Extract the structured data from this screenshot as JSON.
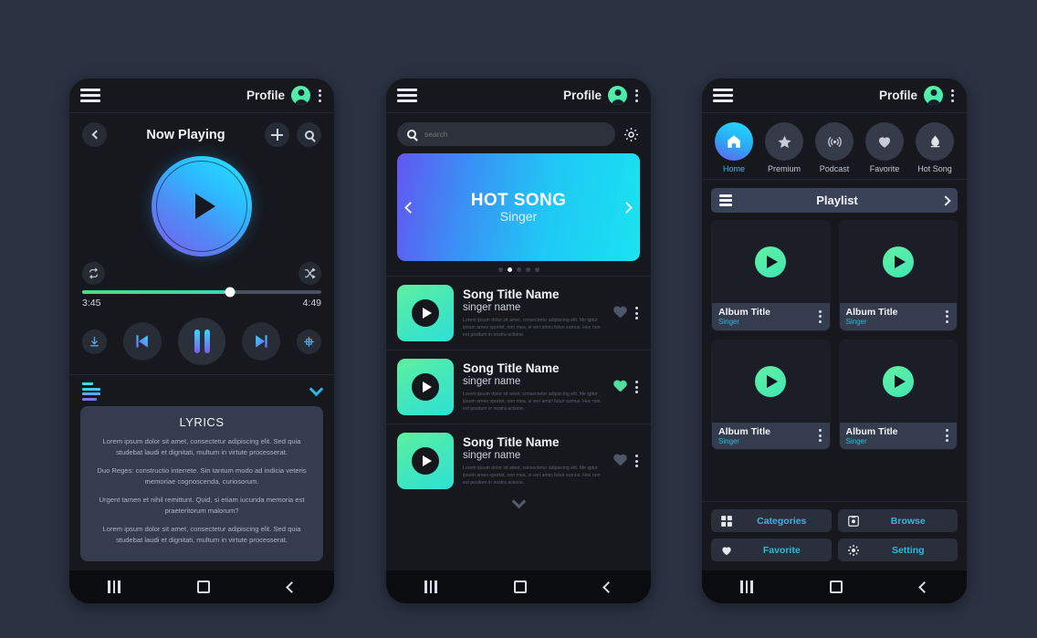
{
  "topbar": {
    "profile_label": "Profile"
  },
  "phone1": {
    "header": {
      "title": "Now Playing"
    },
    "progress": {
      "current_time": "3:45",
      "total_time": "4:49",
      "percent": 62
    },
    "lyrics": {
      "title": "LYRICS",
      "paragraphs": [
        "Lorem ipsum dolor sit amet, consectetur adipiscing elit. Sed quia studebat laudi et dignitati, multum in virtute processerat.",
        "Duo Reges: constructio interrete. Sin tantum modo ad indicia veteris memoriae cognoscenda, curiosorum.",
        "Urgent tamen et nihil remittunt. Quid, si etiam iucunda memoria est praeteritorum malorum?",
        "Lorem ipsum dolor sit amet, consectetur adipiscing elit. Sed quia studebat laudi et dignitati, multum in virtute processerat."
      ]
    }
  },
  "phone2": {
    "search": {
      "placeholder": "search",
      "value": ""
    },
    "banner": {
      "title": "HOT SONG",
      "subtitle": "Singer"
    },
    "carousel": {
      "count": 5,
      "active_index": 1
    },
    "songs": [
      {
        "title": "Song Title Name",
        "singer": "singer name",
        "blurb": "Lorem ipsum dolor sit amet, consectetur adipiscing elit. Me igitur ipsum ames oportet, non mea, si veri amici futuri sumus. Hoc non est positum in nostra actione.",
        "favorite": false
      },
      {
        "title": "Song Title Name",
        "singer": "singer name",
        "blurb": "Lorem ipsum dolor sit amet, consectetur adipiscing elit. Me igitur ipsum ames oportet, non mea, si veri amici futuri sumus. Hoc non est positum in nostra actione.",
        "favorite": true
      },
      {
        "title": "Song Title Name",
        "singer": "singer name",
        "blurb": "Lorem ipsum dolor sit amet, consectetur adipiscing elit. Me igitur ipsum ames oportet, non mea, si veri amici futuri sumus. Hoc non est positum in nostra actione.",
        "favorite": false
      }
    ]
  },
  "phone3": {
    "categories": [
      {
        "label": "Home",
        "icon": "home-icon",
        "active": true
      },
      {
        "label": "Premium",
        "icon": "star-icon",
        "active": false
      },
      {
        "label": "Podcast",
        "icon": "podcast-icon",
        "active": false
      },
      {
        "label": "Favorite",
        "icon": "heart-icon",
        "active": false
      },
      {
        "label": "Hot Song",
        "icon": "flame-icon",
        "active": false
      }
    ],
    "playlist_bar": {
      "label": "Playlist"
    },
    "albums": [
      {
        "title": "Album Title",
        "singer": "Singer"
      },
      {
        "title": "Album Title",
        "singer": "Singer"
      },
      {
        "title": "Album Title",
        "singer": "Singer"
      },
      {
        "title": "Album Title",
        "singer": "Singer"
      }
    ],
    "bottom_menu": [
      {
        "label": "Categories",
        "icon": "grid-icon"
      },
      {
        "label": "Browse",
        "icon": "browse-icon"
      },
      {
        "label": "Favorite",
        "icon": "heart-icon"
      },
      {
        "label": "Setting",
        "icon": "gear-icon"
      }
    ]
  },
  "colors": {
    "page_background": "#2b3242",
    "screen_background": "#16181e",
    "accent_cyan": "#2fb8e0",
    "accent_green": "#4fe09a",
    "card_slate": "#353c4d"
  }
}
